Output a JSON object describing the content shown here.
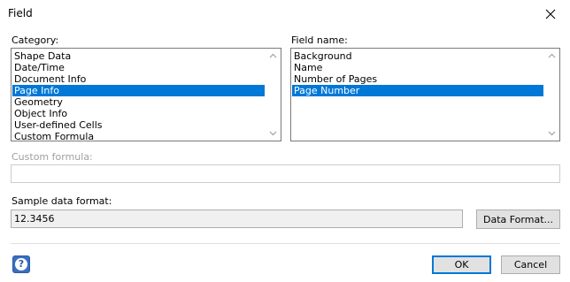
{
  "window": {
    "title": "Field"
  },
  "category": {
    "label": "Category:",
    "items": [
      {
        "label": "Shape Data",
        "selected": false
      },
      {
        "label": "Date/Time",
        "selected": false
      },
      {
        "label": "Document Info",
        "selected": false
      },
      {
        "label": "Page Info",
        "selected": true
      },
      {
        "label": "Geometry",
        "selected": false
      },
      {
        "label": "Object Info",
        "selected": false
      },
      {
        "label": "User-defined Cells",
        "selected": false
      },
      {
        "label": "Custom Formula",
        "selected": false
      }
    ]
  },
  "field_name": {
    "label": "Field name:",
    "items": [
      {
        "label": "Background",
        "selected": false
      },
      {
        "label": "Name",
        "selected": false
      },
      {
        "label": "Number of Pages",
        "selected": false
      },
      {
        "label": "Page Number",
        "selected": true
      }
    ]
  },
  "custom_formula": {
    "label": "Custom formula:",
    "value": ""
  },
  "sample_format": {
    "label": "Sample data format:",
    "value": "12.3456"
  },
  "buttons": {
    "data_format": "Data Format...",
    "ok": "OK",
    "cancel": "Cancel"
  },
  "icons": {
    "close": "close-icon",
    "help": "help-icon",
    "scroll_up": "chevron-up-icon",
    "scroll_down": "chevron-down-icon"
  },
  "colors": {
    "selection": "#0078d7",
    "default_button_border": "#0078d7"
  }
}
